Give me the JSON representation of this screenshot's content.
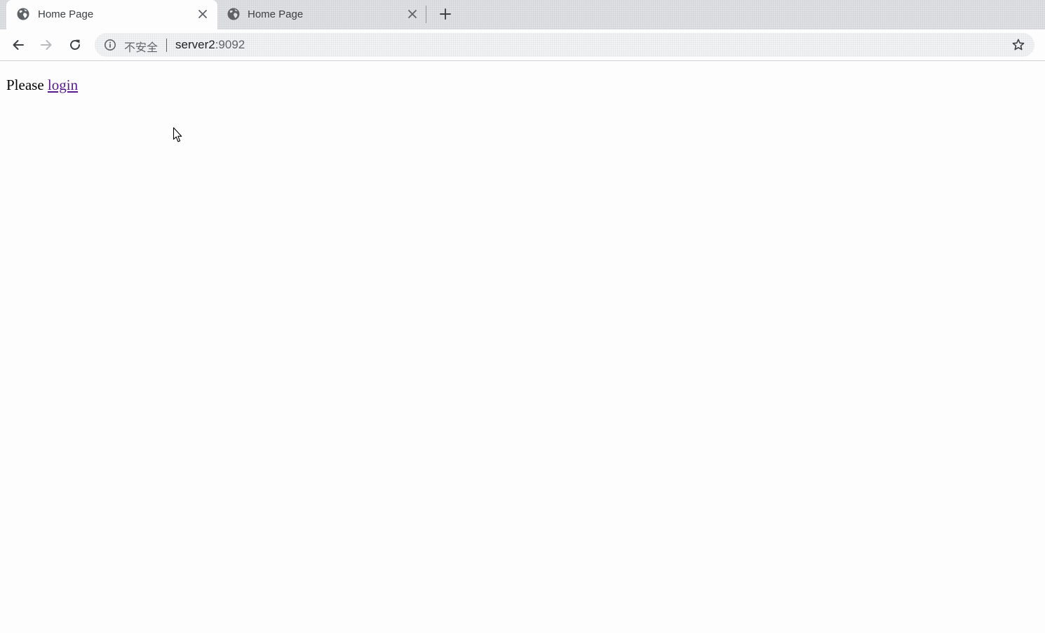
{
  "tabs": [
    {
      "title": "Home Page",
      "icon": "globe-icon",
      "active": true
    },
    {
      "title": "Home Page",
      "icon": "globe-icon",
      "active": false
    }
  ],
  "toolbar": {
    "security_label": "不安全",
    "url_host": "server2",
    "url_port": ":9092"
  },
  "page": {
    "text": "Please",
    "link_label": "login"
  },
  "colors": {
    "link": "#551a8b",
    "tab_strip": "#dfe1e5",
    "omnibox": "#f1f3f4",
    "icon": "#5f6368"
  }
}
